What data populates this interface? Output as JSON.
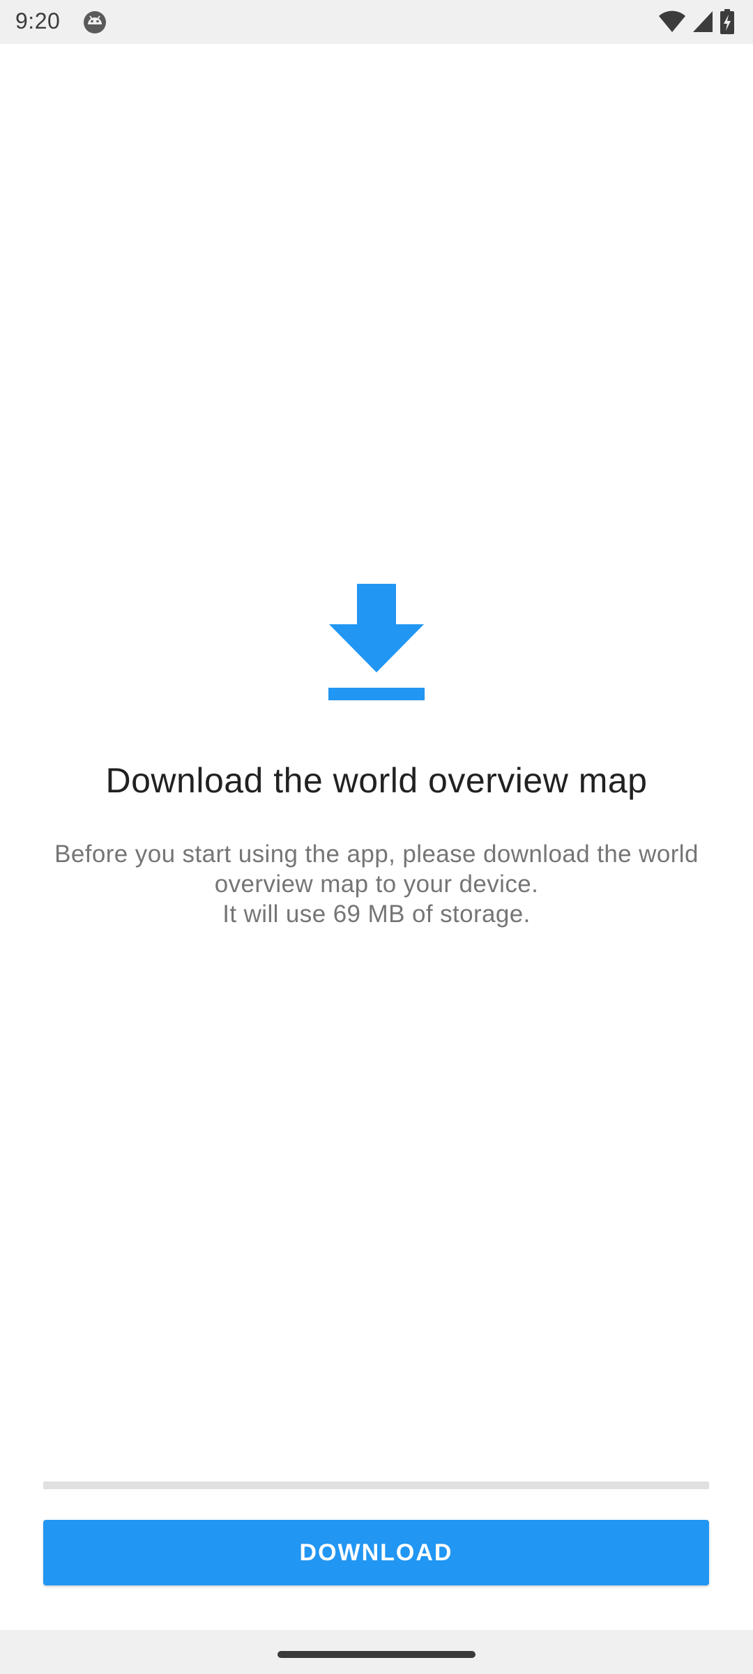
{
  "status_bar": {
    "time": "9:20",
    "notification_icon": "android-robot-icon",
    "icons": [
      "wifi-icon",
      "cell-signal-icon",
      "battery-charging-icon"
    ]
  },
  "main": {
    "illustration_icon": "download-arrow-icon",
    "title": "Download the world overview map",
    "description_lines": [
      "Before you start using the app, please download the world",
      "overview map to your device.",
      "It will use 69 MB of storage."
    ]
  },
  "progress": {
    "value_percent": 0
  },
  "actions": {
    "download_label": "DOWNLOAD"
  },
  "colors": {
    "accent": "#2196f3",
    "title_text": "#212121",
    "body_text": "#757575",
    "progress_track": "#e0e0e0",
    "system_bars": "#f0f0f0"
  }
}
